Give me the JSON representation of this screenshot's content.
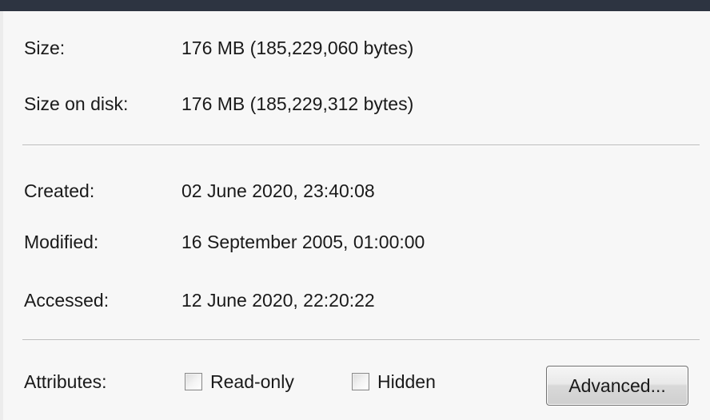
{
  "properties": {
    "size": {
      "label": "Size:",
      "value": "176 MB (185,229,060 bytes)"
    },
    "size_on_disk": {
      "label": "Size on disk:",
      "value": "176 MB (185,229,312 bytes)"
    },
    "created": {
      "label": "Created:",
      "value": "02 June 2020, 23:40:08"
    },
    "modified": {
      "label": "Modified:",
      "value": "16 September 2005, 01:00:00"
    },
    "accessed": {
      "label": "Accessed:",
      "value": "12 June 2020, 22:20:22"
    }
  },
  "attributes": {
    "label": "Attributes:",
    "read_only": {
      "label": "Read-only",
      "checked": false
    },
    "hidden": {
      "label": "Hidden",
      "checked": false
    },
    "advanced_label": "Advanced..."
  },
  "colors": {
    "title_bar": "#2d3441",
    "background": "#f7f7f7",
    "divider": "#b9b9b9"
  }
}
